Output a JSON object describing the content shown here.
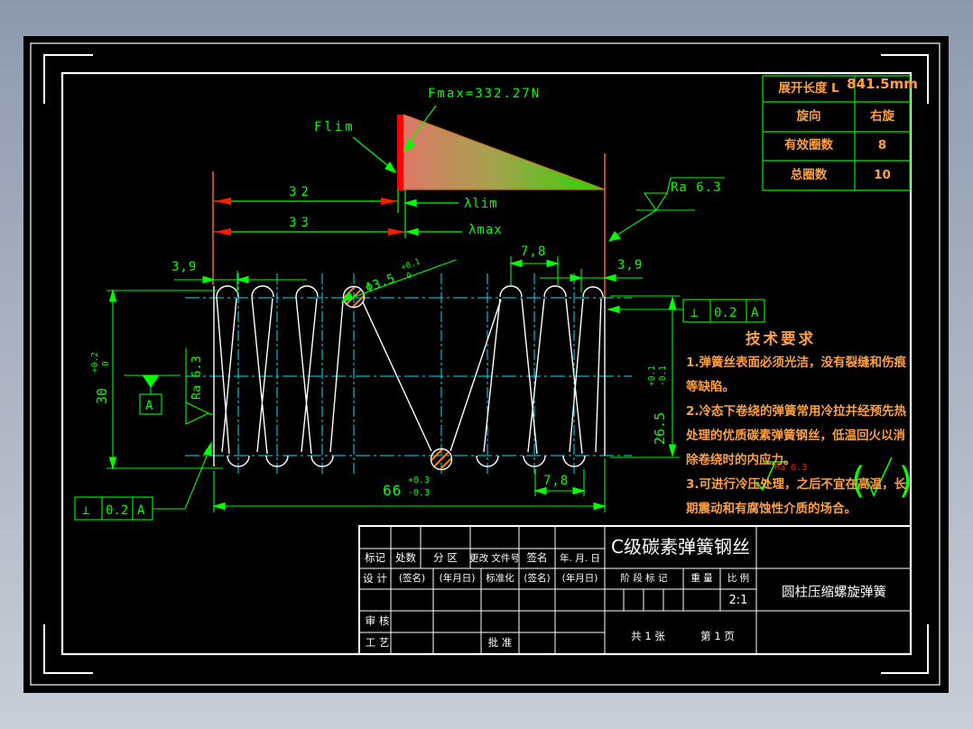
{
  "spec_table": {
    "rows": [
      {
        "label": "展开长度 L",
        "value": "841.5mm"
      },
      {
        "label": "旋向",
        "value": "右旋"
      },
      {
        "label": "有效圈数",
        "value": "8"
      },
      {
        "label": "总圈数",
        "value": "10"
      }
    ]
  },
  "force_diagram": {
    "fmax": "Fmax=332.27N",
    "flim": "Flim",
    "lambda_lim": "λlim",
    "lambda_max": "λmax"
  },
  "dims": {
    "d32": "32",
    "d33": "33",
    "d39_left": "3,9",
    "d39_right": "3,9",
    "pitch_top": "7,8",
    "pitch_bottom": "7,8",
    "free_len": "66",
    "free_len_up": "+0.3",
    "free_len_dn": "-0.3",
    "od": "30",
    "od_up": "+0.2",
    "od_dn": "0",
    "mid_dia": "26.5",
    "mid_up": "+0.1",
    "mid_dn": "-0.1",
    "wire": "Φ3.5",
    "wire_up": "+0.1",
    "wire_dn": "0"
  },
  "surface": {
    "ra_top_right": "Ra 6.3",
    "ra_left": "Ra 6.3",
    "ra_note": "Ra 6.3",
    "paren_open": "(",
    "paren_close": ")"
  },
  "gdt": {
    "perp": "⊥",
    "tol": "0.2",
    "datum": "A",
    "datum_label": "A"
  },
  "tech": {
    "title": "技术要求",
    "lines": [
      "1.弹簧丝表面必须光洁，没有裂缝和伤痕",
      "等缺陷。",
      "2.冷态下卷绕的弹簧常用冷拉并经预先热",
      "处理的优质碳素弹簧钢丝，低温回火以消",
      "除卷绕时的内应力。",
      "3.可进行冷压处理，之后不宜在高温，长",
      "期震动和有腐蚀性介质的场合。"
    ]
  },
  "title_block": {
    "material": "C级碳素弹簧钢丝",
    "part_name": "圆柱压缩螺旋弹簧",
    "stage": "阶 段 标 记",
    "weight": "重 量",
    "scale": "比 例",
    "scale_value": "2:1",
    "sheets": "共 1 张",
    "page": "第 1 页",
    "biaoji": "标记",
    "chushu": "处数",
    "fenqu": "分 区",
    "wenjianhao": "更改 文件号",
    "qianming": "签名",
    "riqi": "年. 月. 日",
    "sheji": "设 计",
    "qm2": "(签名)",
    "rq2": "(年月日)",
    "biaozhunhua": "标准化",
    "qm3": "(签名)",
    "rq3": "(年月日)",
    "shenhe": "审 核",
    "gongyi": "工 艺",
    "pizhun": "批 准"
  }
}
